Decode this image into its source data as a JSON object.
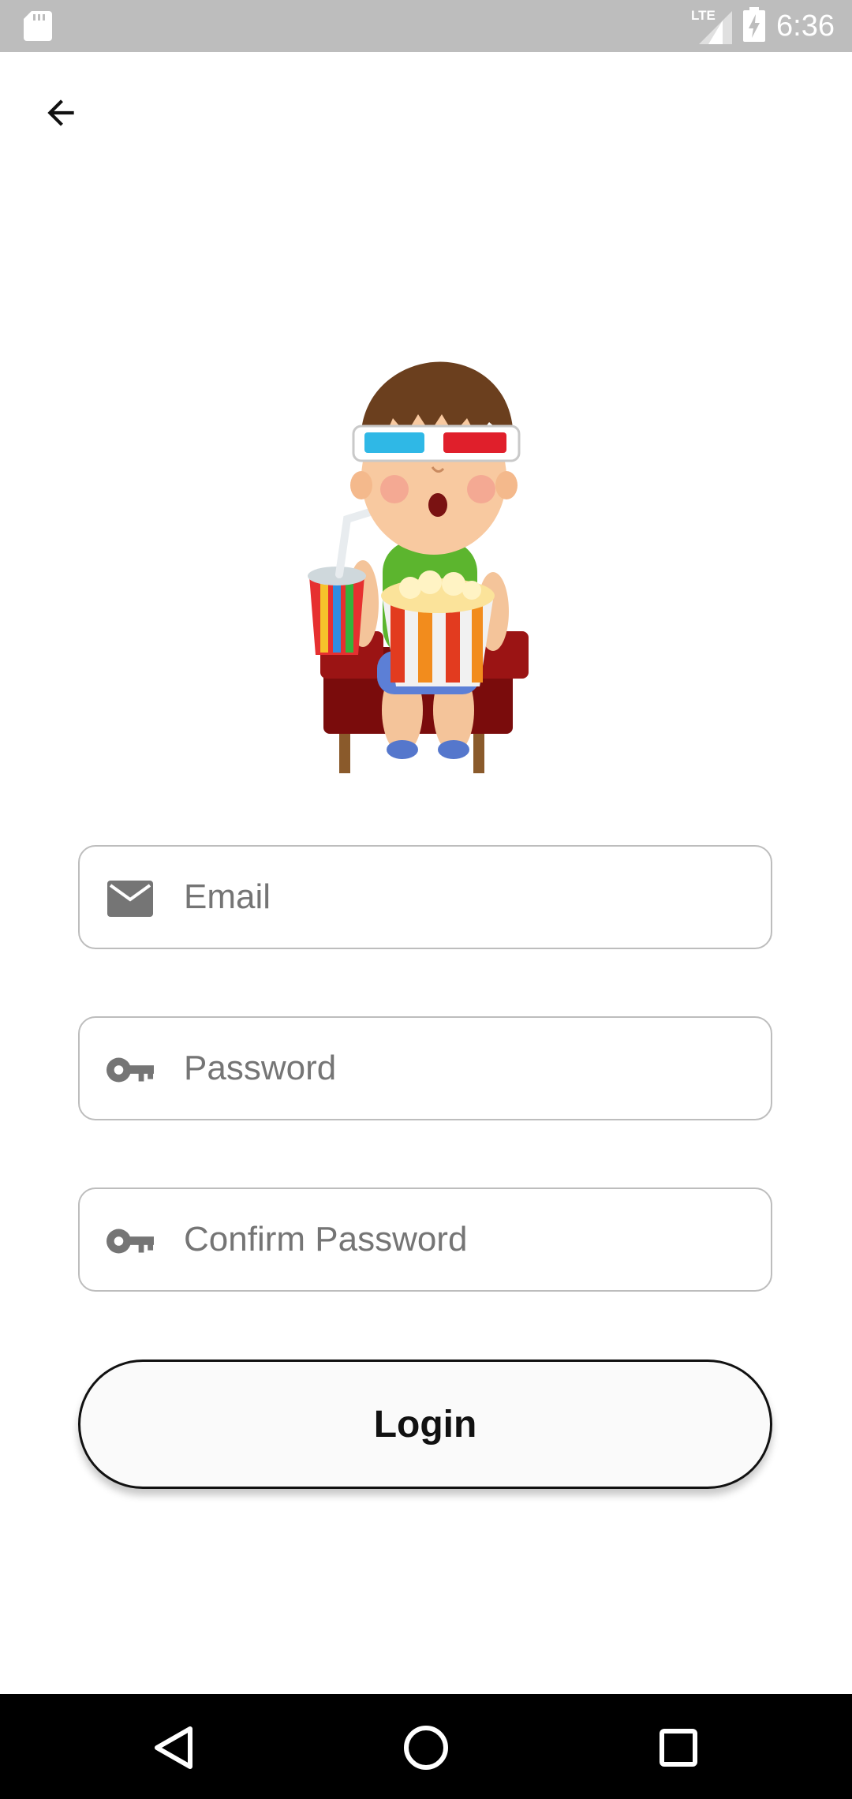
{
  "status_bar": {
    "time": "6:36",
    "network_label": "LTE",
    "icons": [
      "sd-card-icon",
      "lte-signal-icon",
      "battery-charging-icon"
    ]
  },
  "header": {
    "back_icon": "arrow-back-icon"
  },
  "illustration": {
    "subject": "cartoon boy with 3D glasses, popcorn and soda in cinema seat"
  },
  "form": {
    "email": {
      "placeholder": "Email",
      "icon": "mail-icon"
    },
    "password": {
      "placeholder": "Password",
      "icon": "key-icon"
    },
    "confirm_password": {
      "placeholder": "Confirm Password",
      "icon": "key-icon"
    },
    "submit_label": "Login"
  },
  "nav_bar": {
    "icons": [
      "nav-back-icon",
      "nav-home-icon",
      "nav-recents-icon"
    ]
  },
  "colors": {
    "status_bar": "#bdbdbd",
    "field_border": "#bdbdbd",
    "placeholder_text": "#757575",
    "icon_gray": "#757575",
    "button_border": "#111111",
    "nav_bar": "#000000"
  }
}
